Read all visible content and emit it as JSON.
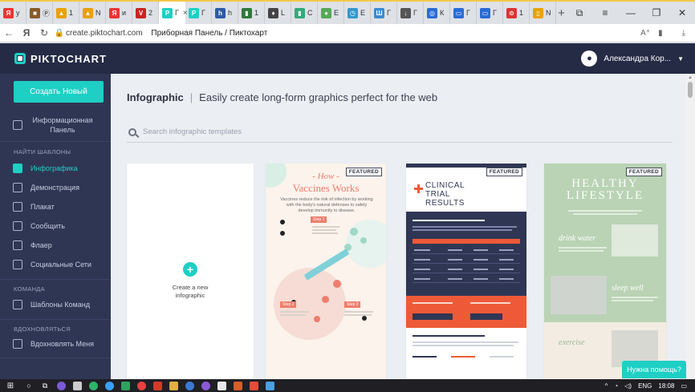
{
  "browser": {
    "tabs": [
      {
        "icon": "Я",
        "label": "у",
        "color": "#e33"
      },
      {
        "icon": "■",
        "label": "Ⓟ",
        "color": "#8a5a2a"
      },
      {
        "icon": "▲",
        "label": "1",
        "color": "#e9a10a"
      },
      {
        "icon": "▲",
        "label": "N",
        "color": "#e9a10a"
      },
      {
        "icon": "Я",
        "label": "и",
        "color": "#e33"
      },
      {
        "icon": "V",
        "label": "2",
        "color": "#c22"
      },
      {
        "icon": "P",
        "label": "Г",
        "color": "#1ecfc4",
        "active": true
      },
      {
        "icon": "P",
        "label": "Г",
        "color": "#1ecfc4"
      },
      {
        "icon": "h",
        "label": "h",
        "color": "#2d5aa8"
      },
      {
        "icon": "▮",
        "label": "1",
        "color": "#2f7a3a"
      },
      {
        "icon": "♦",
        "label": "L",
        "color": "#444"
      },
      {
        "icon": "▮",
        "label": "C",
        "color": "#3a7"
      },
      {
        "icon": "●",
        "label": "E",
        "color": "#5a5"
      },
      {
        "icon": "◷",
        "label": "E",
        "color": "#39c"
      },
      {
        "icon": "Ш",
        "label": "Г",
        "color": "#3a8ad0"
      },
      {
        "icon": "↓",
        "label": "Г",
        "color": "#555"
      },
      {
        "icon": "◎",
        "label": "К",
        "color": "#2a6bd6"
      },
      {
        "icon": "▭",
        "label": "Г",
        "color": "#2a6bd6"
      },
      {
        "icon": "▭",
        "label": "Г",
        "color": "#2a6bd6"
      },
      {
        "icon": "⊙",
        "label": "1",
        "color": "#d33"
      },
      {
        "icon": "▯",
        "label": "N",
        "color": "#e9a10a"
      }
    ],
    "new_tab": "+",
    "url_host": "create.piktochart.com",
    "page_title": "Приборная Панель / Пиктохарт"
  },
  "app": {
    "logo": "PIKTOCHART",
    "user_name": "Александра Кор...",
    "create_button": "Создать Новый",
    "dashboard": "Информационная Панель",
    "section_templates": "НАЙТИ ШАБЛОНЫ",
    "nav": [
      {
        "label": "Инфографика",
        "active": true
      },
      {
        "label": "Демонстрация"
      },
      {
        "label": "Плакат"
      },
      {
        "label": "Сообщить"
      },
      {
        "label": "Флаер"
      },
      {
        "label": "Социальные Сети"
      }
    ],
    "section_team": "КОМАНДА",
    "team_templates": "Шаблоны Команд",
    "section_inspire": "ВДОХНОВЛЯТЬСЯ",
    "inspire_me": "Вдохновлять Меня"
  },
  "main": {
    "title": "Infographic",
    "separator": "|",
    "subtitle": "Easily create long-form graphics perfect for the web",
    "search_placeholder": "Search infographic templates",
    "create_new_label": "Create a new infographic",
    "featured": "FEATURED",
    "vax_title1": "- How -",
    "vax_title2": "Vaccines Works",
    "vax_desc": "Vaccines reduce the risk of infection by working with the body's natural defenses to safely develop immunity to disease.",
    "vax_step1": "Step 1",
    "vax_step2": "Step 2",
    "vax_step3": "Step 3",
    "clin_title": "CLINICAL TRIAL RESULTS",
    "life_title": "HEALTHY LIFESTYLE",
    "life_drink": "drink water",
    "life_sleep": "sleep well",
    "life_exercise": "exercise"
  },
  "help": "Нужна помощь?",
  "taskbar": {
    "lang": "ENG",
    "time": "18:08"
  },
  "colors": {
    "accent": "#1ecfc4",
    "header": "#252b45",
    "sidebar": "#2f3654",
    "clinical_orange": "#ee5a38",
    "vaccine_coral": "#ee7d6c",
    "lifestyle_green": "#b9d3b4"
  }
}
